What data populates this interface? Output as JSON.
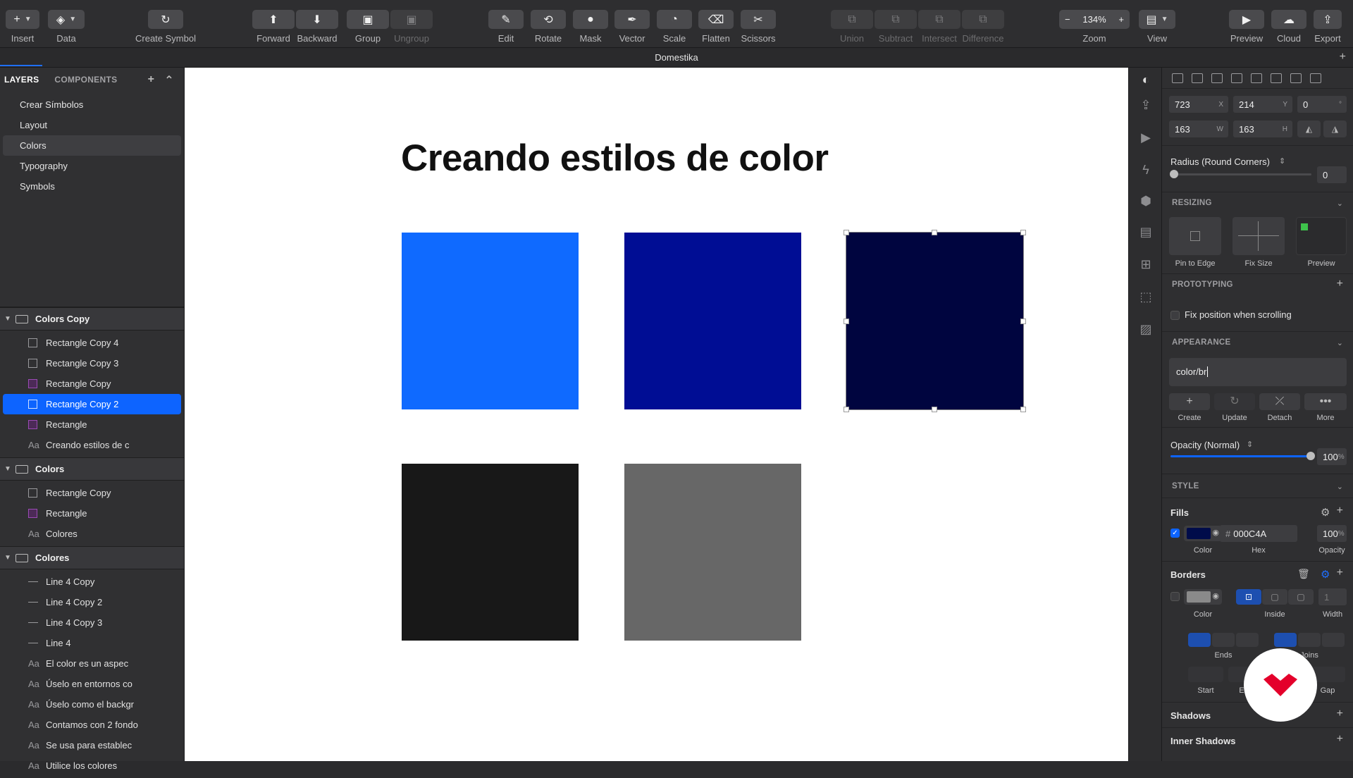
{
  "toolbar": {
    "insert": "Insert",
    "data": "Data",
    "create_symbol": "Create Symbol",
    "forward": "Forward",
    "backward": "Backward",
    "group": "Group",
    "ungroup": "Ungroup",
    "edit": "Edit",
    "rotate": "Rotate",
    "mask": "Mask",
    "vector": "Vector",
    "scale": "Scale",
    "flatten": "Flatten",
    "scissors": "Scissors",
    "union": "Union",
    "subtract": "Subtract",
    "intersect": "Intersect",
    "difference": "Difference",
    "zoom_label": "Zoom",
    "zoom_value": "134%",
    "view": "View",
    "preview": "Preview",
    "cloud": "Cloud",
    "export": "Export"
  },
  "document_title": "Domestika",
  "left_panel": {
    "tab_layers": "LAYERS",
    "tab_components": "COMPONENTS",
    "pages": [
      "Crear Símbolos",
      "Layout",
      "Colors",
      "Typography",
      "Symbols"
    ],
    "selected_page": "Colors",
    "artboards": [
      {
        "name": "Colors Copy",
        "layers": [
          {
            "type": "shape",
            "color": "gray",
            "name": "Rectangle Copy 4"
          },
          {
            "type": "shape",
            "color": "gray",
            "name": "Rectangle Copy 3"
          },
          {
            "type": "shape",
            "color": "purple",
            "name": "Rectangle Copy"
          },
          {
            "type": "shape",
            "color": "blue",
            "name": "Rectangle Copy 2",
            "selected": true
          },
          {
            "type": "shape",
            "color": "purple",
            "name": "Rectangle"
          },
          {
            "type": "text",
            "name": "Creando estilos de c"
          }
        ]
      },
      {
        "name": "Colors",
        "layers": [
          {
            "type": "shape",
            "color": "gray",
            "name": "Rectangle Copy"
          },
          {
            "type": "shape",
            "color": "purple",
            "name": "Rectangle"
          },
          {
            "type": "text",
            "name": "Colores"
          }
        ]
      },
      {
        "name": "Colores",
        "layers": [
          {
            "type": "line",
            "name": "Line 4 Copy"
          },
          {
            "type": "line",
            "name": "Line 4 Copy 2"
          },
          {
            "type": "line",
            "name": "Line 4 Copy 3"
          },
          {
            "type": "line",
            "name": "Line 4"
          },
          {
            "type": "text",
            "name": "El color es un aspec"
          },
          {
            "type": "text",
            "name": "Úselo en entornos co"
          },
          {
            "type": "text",
            "name": "Úselo como el backgr"
          },
          {
            "type": "text",
            "name": "Contamos con 2 fondo"
          },
          {
            "type": "text",
            "name": "Se usa para establec"
          },
          {
            "type": "text",
            "name": "Utilice los colores"
          }
        ]
      }
    ],
    "text_glyph": "Aa"
  },
  "canvas": {
    "heading": "Creando estilos de color",
    "swatches": [
      "#0f6aff",
      "#000d94",
      "#00053f",
      "#181818",
      "#676767"
    ]
  },
  "inspector": {
    "x": "723",
    "x_unit": "X",
    "y": "214",
    "y_unit": "Y",
    "rotation": "0",
    "rotation_unit": "°",
    "w": "163",
    "w_unit": "W",
    "h": "163",
    "h_unit": "H",
    "radius_label": "Radius (Round Corners)",
    "radius_value": "0",
    "resizing": "RESIZING",
    "pin_to_edge": "Pin to Edge",
    "fix_size": "Fix Size",
    "preview": "Preview",
    "prototyping": "PROTOTYPING",
    "fix_position": "Fix position when scrolling",
    "appearance": "APPEARANCE",
    "style_name": "color/br",
    "create": "Create",
    "update": "Update",
    "detach": "Detach",
    "more": "More",
    "opacity_label": "Opacity (Normal)",
    "opacity_value": "100",
    "opacity_unit": "%",
    "style": "STYLE",
    "fills": "Fills",
    "fill_color": "#000C4A",
    "fill_hex": "000C4A",
    "hash": "#",
    "fill_opacity": "100",
    "fill_opacity_unit": "%",
    "color": "Color",
    "hex": "Hex",
    "opacity": "Opacity",
    "borders": "Borders",
    "border_color": "#8a8a8a",
    "inside": "Inside",
    "width": "Width",
    "width_value": "1",
    "ends": "Ends",
    "joins": "Joins",
    "start": "Start",
    "end": "End",
    "gap": "Gap",
    "shadows": "Shadows",
    "inner_shadows": "Inner Shadows"
  },
  "colors": {
    "accent": "#0d64ff",
    "toolbar": "#2e2e30",
    "panel": "#303032"
  }
}
